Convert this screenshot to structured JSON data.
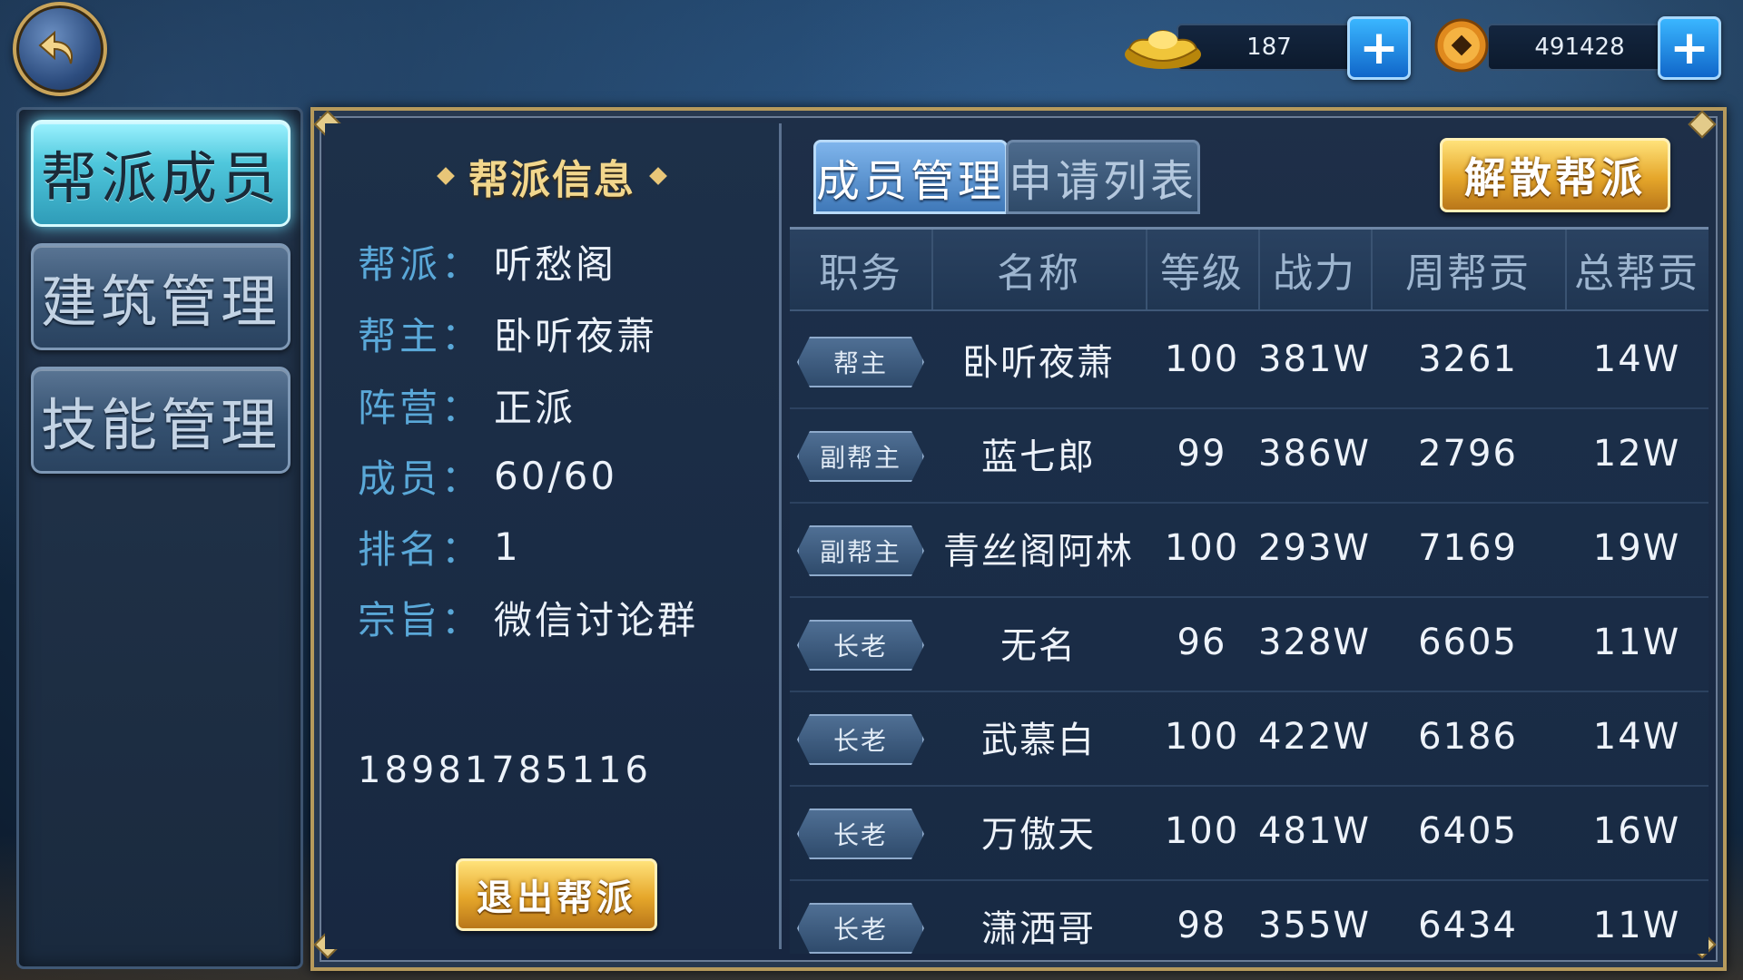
{
  "currency": {
    "gold_ingot": {
      "icon": "gold-ingot-icon",
      "value": "187"
    },
    "copper_coin": {
      "icon": "copper-coin-icon",
      "value": "491428"
    }
  },
  "sidebar": {
    "items": [
      {
        "label": "帮派成员",
        "active": true
      },
      {
        "label": "建筑管理",
        "active": false
      },
      {
        "label": "技能管理",
        "active": false
      }
    ]
  },
  "guild_info": {
    "title": "帮派信息",
    "rows": [
      {
        "label": "帮派：",
        "value": "听愁阁"
      },
      {
        "label": "帮主：",
        "value": "卧听夜萧"
      },
      {
        "label": "阵营：",
        "value": "正派"
      },
      {
        "label": "成员：",
        "value": "60/60"
      },
      {
        "label": "排名：",
        "value": "1"
      },
      {
        "label": "宗旨：",
        "value": "微信讨论群"
      }
    ],
    "motto_second_line": "18981785116",
    "quit_button": "退出帮派"
  },
  "tabs": [
    {
      "label": "成员管理",
      "active": true
    },
    {
      "label": "申请列表",
      "active": false
    }
  ],
  "disband_button": "解散帮派",
  "table": {
    "headers": [
      "职务",
      "名称",
      "等级",
      "战力",
      "周帮贡",
      "总帮贡"
    ],
    "rows": [
      {
        "role": "帮主",
        "name": "卧听夜萧",
        "level": "100",
        "power": "381W",
        "weekly": "3261",
        "total": "14W"
      },
      {
        "role": "副帮主",
        "name": "蓝七郎",
        "level": "99",
        "power": "386W",
        "weekly": "2796",
        "total": "12W"
      },
      {
        "role": "副帮主",
        "name": "青丝阁阿林",
        "level": "100",
        "power": "293W",
        "weekly": "7169",
        "total": "19W"
      },
      {
        "role": "长老",
        "name": "无名",
        "level": "96",
        "power": "328W",
        "weekly": "6605",
        "total": "11W"
      },
      {
        "role": "长老",
        "name": "武慕白",
        "level": "100",
        "power": "422W",
        "weekly": "6186",
        "total": "14W"
      },
      {
        "role": "长老",
        "name": "万傲天",
        "level": "100",
        "power": "481W",
        "weekly": "6405",
        "total": "16W"
      },
      {
        "role": "长老",
        "name": "潇洒哥",
        "level": "98",
        "power": "355W",
        "weekly": "6434",
        "total": "11W"
      }
    ]
  }
}
